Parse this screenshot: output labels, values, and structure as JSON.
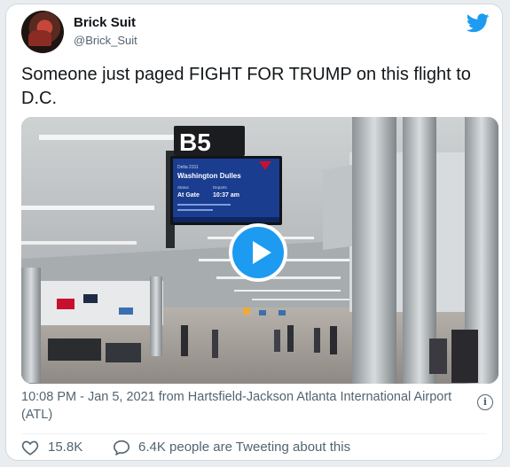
{
  "tweet": {
    "author": {
      "display_name": "Brick Suit",
      "handle": "@Brick_Suit",
      "avatar_icon": "profile-photo"
    },
    "brand_icon": "twitter-bird-icon",
    "brand_color": "#1d9bf0",
    "text": "Someone just paged FIGHT FOR TRUMP on this flight to D.C.",
    "media": {
      "type": "video",
      "gate_sign": "B5",
      "monitor": {
        "airline": "Delta 2311",
        "destination": "Washington Dulles",
        "status_label": "Status",
        "status_value": "At Gate",
        "departs_label": "Departs",
        "departs_value": "10:37 am"
      },
      "play_icon": "play-icon"
    },
    "meta": "10:08 PM - Jan 5, 2021 from Hartsfield-Jackson Atlanta International Airport (ATL)",
    "info_icon": "info-icon",
    "like_icon": "heart-icon",
    "like_count": "15.8K",
    "reply_icon": "speech-bubble-icon",
    "tweeting_text": "6.4K people are Tweeting about this"
  }
}
